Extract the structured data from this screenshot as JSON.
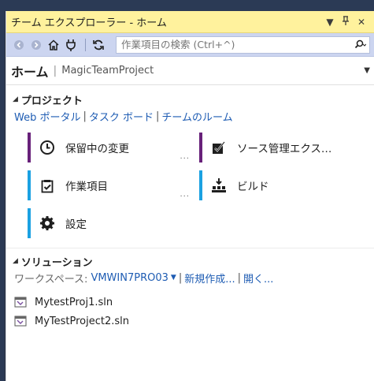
{
  "titlebar": {
    "title": "チーム エクスプローラー - ホーム",
    "dropdown_icon": "chevron-down-icon",
    "pin_icon": "pin-icon",
    "close_icon": "close-icon"
  },
  "toolbar": {
    "icons": [
      "back-icon",
      "forward-icon",
      "home-icon",
      "connect-icon",
      "refresh-icon"
    ],
    "search_placeholder": "作業項目の検索 (Ctrl+^)"
  },
  "page": {
    "title": "ホーム",
    "separator": "|",
    "project_name": "MagicTeamProject"
  },
  "project_section": {
    "header": "プロジェクト",
    "links": [
      "Web ポータル",
      "タスク ボード",
      "チームのルーム"
    ],
    "tiles": [
      {
        "label": "保留中の変更",
        "icon": "clock-icon",
        "accent": "#68217a",
        "more": "..."
      },
      {
        "label": "ソース管理エクス…",
        "icon": "checkbox-icon",
        "accent": "#68217a",
        "more": ""
      },
      {
        "label": "作業項目",
        "icon": "clipboard-check-icon",
        "accent": "#1ba1e2",
        "more": "..."
      },
      {
        "label": "ビルド",
        "icon": "build-icon",
        "accent": "#1ba1e2",
        "more": ""
      },
      {
        "label": "設定",
        "icon": "gear-icon",
        "accent": "#1ba1e2",
        "more": ""
      }
    ]
  },
  "solutions_section": {
    "header": "ソリューション",
    "workspace_label": "ワークスペース:",
    "workspace_value": "VMWIN7PRO03",
    "new_link": "新規作成...",
    "open_link": "開く...",
    "files": [
      "MytestProj1.sln",
      "MyTestProject2.sln"
    ]
  }
}
